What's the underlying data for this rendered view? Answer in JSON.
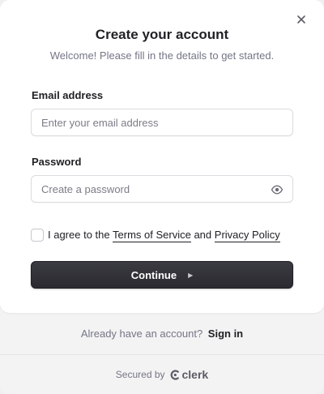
{
  "header": {
    "title": "Create your account",
    "subtitle": "Welcome! Please fill in the details to get started.",
    "close_icon": "close-icon"
  },
  "form": {
    "email": {
      "label": "Email address",
      "placeholder": "Enter your email address",
      "value": ""
    },
    "password": {
      "label": "Password",
      "placeholder": "Create a password",
      "value": "",
      "toggle_icon": "eye-icon"
    },
    "terms": {
      "checked": false,
      "prefix": "I agree to the",
      "terms_link": "Terms of Service",
      "joiner": "and",
      "privacy_link": "Privacy Policy"
    },
    "submit_label": "Continue"
  },
  "footer": {
    "signin_prompt": "Already have an account?",
    "signin_link": "Sign in",
    "secured_by": "Secured by",
    "brand": "clerk"
  },
  "colors": {
    "primary_button": "#2f2f35",
    "text": "#212126",
    "muted": "#747686",
    "footer_bg": "#f3f3f3"
  }
}
